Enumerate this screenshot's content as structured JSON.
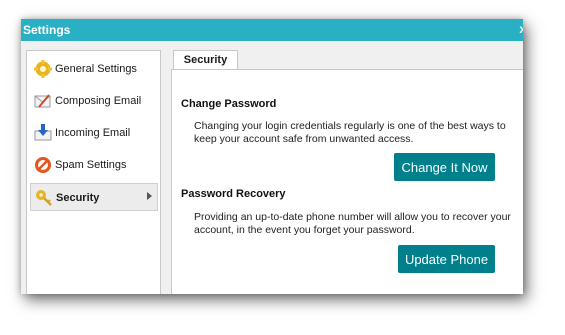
{
  "window": {
    "title": "Settings",
    "close_glyph": "x"
  },
  "sidebar": {
    "items": [
      {
        "label": "General Settings",
        "icon": "gear-icon"
      },
      {
        "label": "Composing Email",
        "icon": "compose-icon"
      },
      {
        "label": "Incoming Email",
        "icon": "incoming-icon"
      },
      {
        "label": "Spam Settings",
        "icon": "spam-icon"
      },
      {
        "label": "Security",
        "icon": "key-icon",
        "active": true
      }
    ]
  },
  "tab": {
    "label": "Security"
  },
  "change_password": {
    "heading": "Change Password",
    "description": "Changing your login credentials regularly is one of the best ways to keep your account safe from unwanted access.",
    "button": "Change It Now"
  },
  "password_recovery": {
    "heading": "Password Recovery",
    "description": "Providing an up-to-date phone number will allow you to recover your account, in the event you forget your password.",
    "button": "Update Phone"
  },
  "colors": {
    "titlebar": "#2ab0c5",
    "button": "#007f8c"
  }
}
